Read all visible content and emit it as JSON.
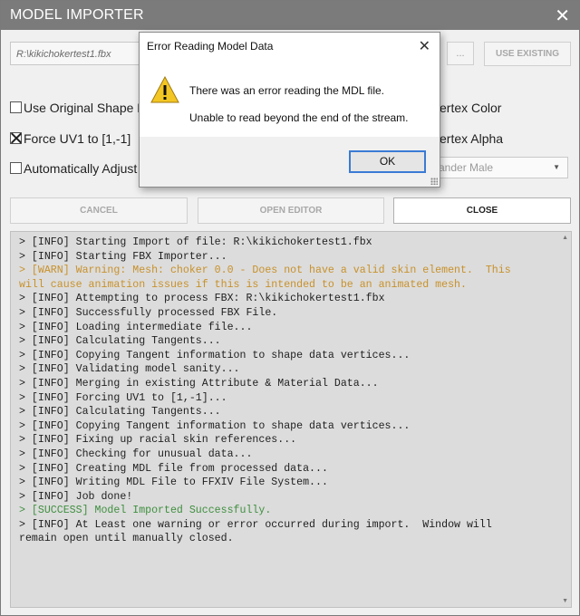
{
  "window": {
    "title": "MODEL IMPORTER",
    "close_glyph": "✕"
  },
  "file": {
    "path": "R:\\kikichokertest1.fbx",
    "browse_label": "...",
    "use_existing_label": "USE EXISTING"
  },
  "options": {
    "use_original_shape": "Use Original Shape D",
    "force_uv1": "Force UV1 to [1,-1]",
    "auto_adjust": "Automatically Adjust",
    "vertex_color": "ertex Color",
    "vertex_alpha": "ertex Alpha",
    "race_select": "ander Male",
    "use_original_checked": false,
    "force_uv1_checked": true,
    "auto_adjust_checked": false
  },
  "buttons": {
    "cancel": "CANCEL",
    "open_editor": "OPEN EDITOR",
    "close": "CLOSE"
  },
  "log": {
    "lines": [
      {
        "text": "> [INFO] Starting Import of file: R:\\kikichokertest1.fbx",
        "level": "info"
      },
      {
        "text": "> [INFO] Starting FBX Importer...",
        "level": "info"
      },
      {
        "text": "> [WARN] Warning: Mesh: choker 0.0 - Does not have a valid skin element.  This\nwill cause animation issues if this is intended to be an animated mesh.",
        "level": "warn"
      },
      {
        "text": "> [INFO] Attempting to process FBX: R:\\kikichokertest1.fbx",
        "level": "info"
      },
      {
        "text": "> [INFO] Successfully processed FBX File.",
        "level": "info"
      },
      {
        "text": "> [INFO] Loading intermediate file...",
        "level": "info"
      },
      {
        "text": "> [INFO] Calculating Tangents...",
        "level": "info"
      },
      {
        "text": "> [INFO] Copying Tangent information to shape data vertices...",
        "level": "info"
      },
      {
        "text": "> [INFO] Validating model sanity...",
        "level": "info"
      },
      {
        "text": "> [INFO] Merging in existing Attribute & Material Data...",
        "level": "info"
      },
      {
        "text": "> [INFO] Forcing UV1 to [1,-1]...",
        "level": "info"
      },
      {
        "text": "> [INFO] Calculating Tangents...",
        "level": "info"
      },
      {
        "text": "> [INFO] Copying Tangent information to shape data vertices...",
        "level": "info"
      },
      {
        "text": "> [INFO] Fixing up racial skin references...",
        "level": "info"
      },
      {
        "text": "> [INFO] Checking for unusual data...",
        "level": "info"
      },
      {
        "text": "> [INFO] Creating MDL file from processed data...",
        "level": "info"
      },
      {
        "text": "> [INFO] Writing MDL File to FFXIV File System...",
        "level": "info"
      },
      {
        "text": "> [INFO] Job done!",
        "level": "info"
      },
      {
        "text": "> [SUCCESS] Model Imported Successfully.",
        "level": "success"
      },
      {
        "text": "> [INFO] At Least one warning or error occurred during import.  Window will\nremain open until manually closed.",
        "level": "info"
      }
    ]
  },
  "dialog": {
    "title": "Error Reading Model Data",
    "message1": "There was an error reading the MDL file.",
    "message2": "Unable to read beyond the end of the stream.",
    "ok_label": "OK",
    "close_glyph": "✕",
    "icon": "warning-icon"
  },
  "colors": {
    "titlebar": "#7b7b7b",
    "warn_text": "#c8912a",
    "success_text": "#3f8f3f",
    "ok_border": "#3a7bd5"
  }
}
